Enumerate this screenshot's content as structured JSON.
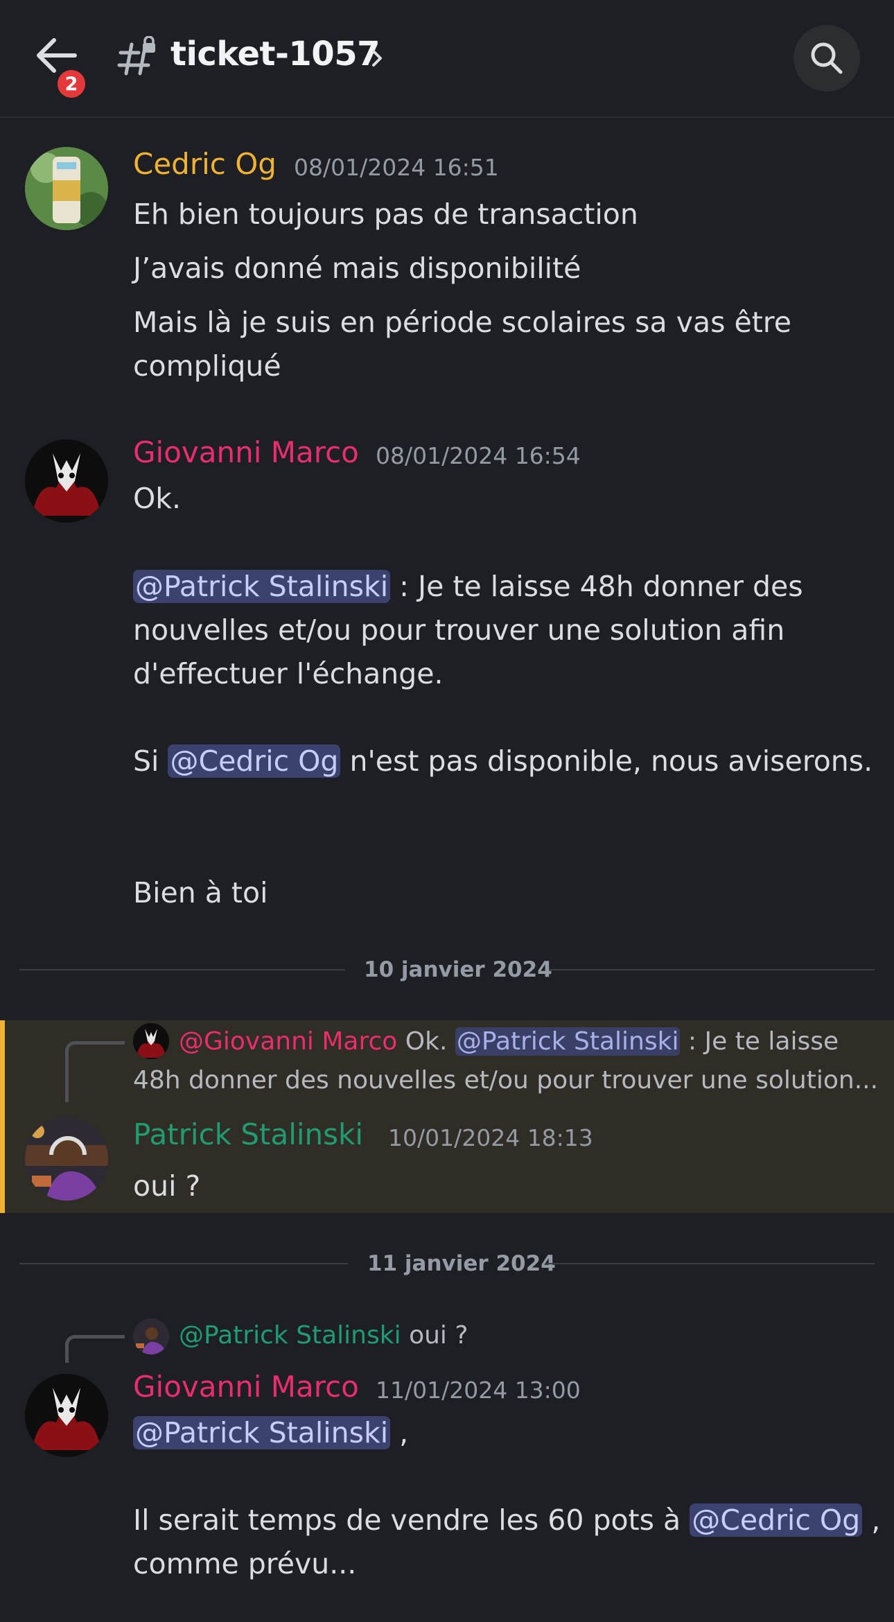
{
  "header": {
    "back_badge_count": "2",
    "channel_name": "ticket-1057"
  },
  "messages": [
    {
      "author": "Cedric Og",
      "author_color": "#f0b232",
      "timestamp": "08/01/2024 16:51",
      "lines": [
        "Eh bien toujours pas de transaction",
        "J’avais donné mais disponibilité",
        "Mais là je suis en période scolaires sa vas être",
        "compliqué"
      ]
    },
    {
      "author": "Giovanni Marco",
      "author_color": "#eb2d6e",
      "timestamp": "08/01/2024 16:54",
      "line1": "Ok.",
      "mention_patrick": "@Patrick Stalinski",
      "line2_rest": " : Je te laisse 48h donner des",
      "line3": "nouvelles et/ou pour trouver une solution afin",
      "line4": "d'effectuer l'échange.",
      "line5_prefix": "Si ",
      "mention_cedric": "@Cedric Og",
      "line5_rest": " n'est pas disponible, nous aviserons.",
      "line6": "Bien à toi"
    },
    {
      "reply_author": "@Giovanni Marco",
      "reply_text_a": "Ok. ",
      "reply_mention": "@Patrick Stalinski",
      "reply_text_b": " : Je te laisse",
      "reply_line2": "48h donner des nouvelles et/ou pour trouver une solution...",
      "author": "Patrick Stalinski",
      "author_color": "#1f9c72",
      "timestamp": "10/01/2024 18:13",
      "text": "oui ?"
    },
    {
      "reply_author": "@Patrick Stalinski",
      "reply_text": "oui ?",
      "author": "Giovanni Marco",
      "author_color": "#eb2d6e",
      "timestamp": "11/01/2024 13:00",
      "mention_patrick": "@Patrick Stalinski",
      "line1_rest": " ,",
      "line2_prefix": "Il serait temps de vendre les 60 pots à ",
      "mention_cedric": "@Cedric Og",
      "line2_rest": " ,",
      "line3": "comme prévu..."
    }
  ],
  "dividers": [
    "10 janvier 2024",
    "11 janvier 2024"
  ]
}
